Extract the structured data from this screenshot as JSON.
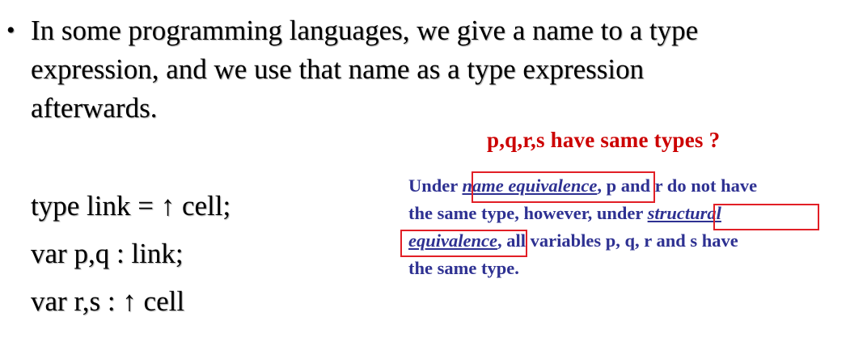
{
  "bullet": {
    "symbol": "•",
    "lines": [
      "In some programming languages, we give a name to a type",
      "expression, and we use that name as a type expression",
      "afterwards."
    ]
  },
  "question": "p,q,r,s have same types ?",
  "code": {
    "lines": [
      "type link = ↑ cell;",
      "var p,q : link;",
      "var r,s : ↑ cell"
    ]
  },
  "note": {
    "line1_a": "Under ",
    "term_name_equivalence": "name equivalence",
    "line1_b": ", p and r do not have",
    "line2_a": "the same type, however, under ",
    "term_structural": "structural",
    "term_equivalence": "equivalence",
    "line3_b": ", all variables p, q, r and s have",
    "line4": "the same type."
  },
  "colors": {
    "question": "#cc0000",
    "note": "#2e3192",
    "highlight_box": "#e21f26"
  }
}
